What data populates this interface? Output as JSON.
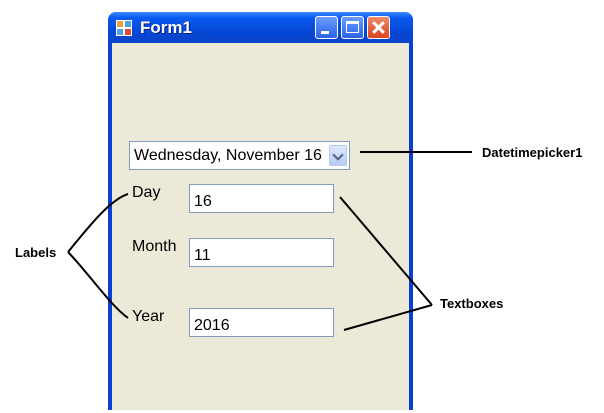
{
  "window": {
    "title": "Form1",
    "controls": [
      "minimize-icon",
      "maximize-icon",
      "close-icon"
    ]
  },
  "datetimepicker": {
    "value": "Wednesday, November 16"
  },
  "labels": {
    "day": "Day",
    "month": "Month",
    "year": "Year"
  },
  "textboxes": {
    "day": "16",
    "month": "11",
    "year": "2016"
  },
  "annotations": {
    "datetimepicker": "Datetimepicker1",
    "labels": "Labels",
    "textboxes": "Textboxes"
  },
  "colors": {
    "titlebar": "#0548d8",
    "client": "#ece9d8",
    "close_button": "#d9431e"
  }
}
